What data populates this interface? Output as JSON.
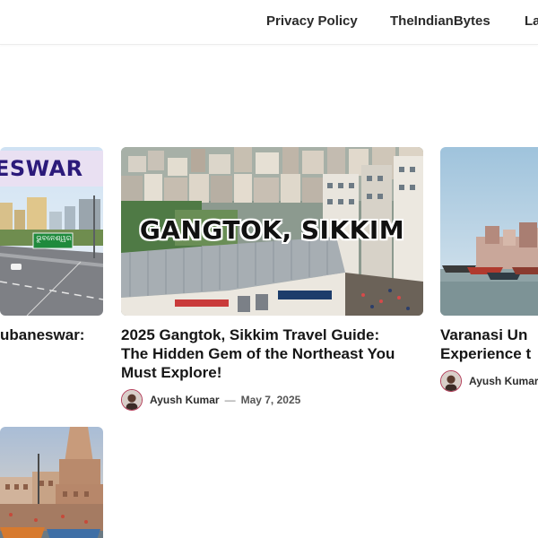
{
  "nav": {
    "items": [
      {
        "label": "Privacy Policy"
      },
      {
        "label": "TheIndianBytes"
      },
      {
        "label": "La"
      }
    ]
  },
  "cards": [
    {
      "image_text": "ESWAR",
      "sign_text": "ଭୁବନେଶ୍ୱର",
      "title_line1": "ubaneswar:"
    },
    {
      "image_text": "GANGTOK, SIKKIM",
      "title_line1": "2025 Gangtok, Sikkim Travel Guide:",
      "title_line2": "The Hidden Gem of the Northeast You",
      "title_line3": "Must Explore!",
      "author": "Ayush Kumar",
      "separator": "—",
      "date": "May 7, 2025"
    },
    {
      "title_line1": "Varanasi Un",
      "title_line2": "Experience t",
      "author": "Ayush Kumar"
    }
  ],
  "colors": {
    "avatar_ring": "#b23a57",
    "text": "#161616"
  }
}
